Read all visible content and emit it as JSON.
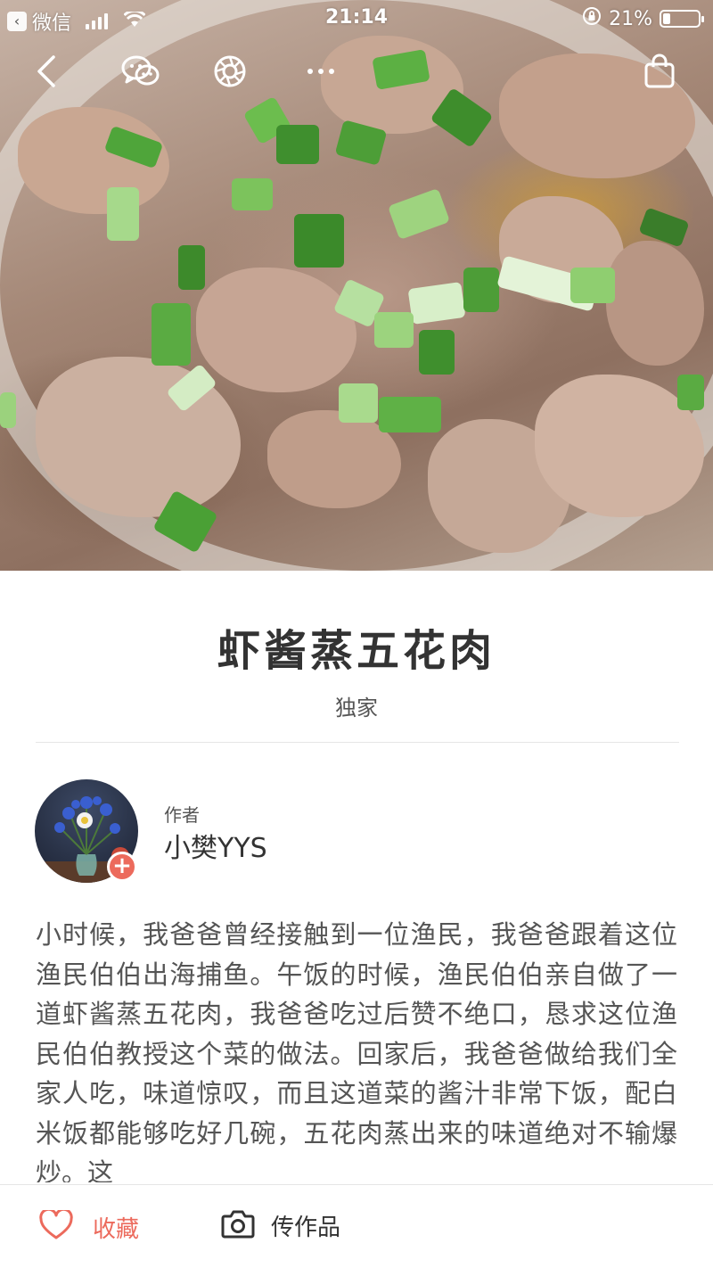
{
  "status_bar": {
    "back_app_label": "微信",
    "time": "21:14",
    "battery_percent": "21%",
    "battery_level": 0.21
  },
  "nav": {
    "icons": [
      "back-icon",
      "wechat-icon",
      "moments-icon",
      "more-icon",
      "shopping-bag-icon"
    ]
  },
  "recipe": {
    "title": "虾酱蒸五花肉",
    "subtitle": "独家"
  },
  "author": {
    "label": "作者",
    "name": "小樊YYS",
    "add_symbol": "+"
  },
  "description": "小时候，我爸爸曾经接触到一位渔民，我爸爸跟着这位渔民伯伯出海捕鱼。午饭的时候，渔民伯伯亲自做了一道虾酱蒸五花肉，我爸爸吃过后赞不绝口，恳求这位渔民伯伯教授这个菜的做法。回家后，我爸爸做给我们全家人吃，味道惊叹，而且这道菜的酱汁非常下饭，配白米饭都能够吃好几碗，五花肉蒸出来的味道绝对不输爆炒。这",
  "bottom_bar": {
    "favorite_label": "收藏",
    "upload_label": "传作品"
  },
  "colors": {
    "accent": "#ec6a5c",
    "text_primary": "#333333",
    "text_secondary": "#555555",
    "divider": "#e6e6e6"
  }
}
